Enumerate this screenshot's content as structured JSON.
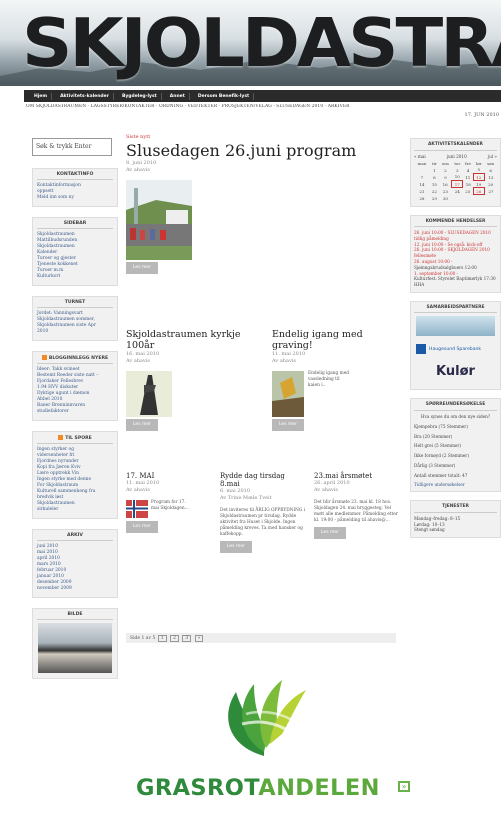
{
  "site": {
    "title": "SKJOLDASTRAUMEN",
    "nav": [
      "Hjem",
      "Aktivitets-kalender",
      "Bygdeleg-lyst",
      "Annet",
      "Dersom Benefik-lyst"
    ],
    "subnav": "OM SKJOLDASTRAUMEN · LAGSSTYRER/KONTAKTER · ORDNING · VEDTEKTER · PROSJEKTEN/VELAG · SLUSEDAGEN 2010 · ARKIVER",
    "date": "17. JUN 2010"
  },
  "left": {
    "search_placeholder": "Søk & trykk Enter",
    "boxes": [
      {
        "title": "Kontaktinfo",
        "lines": [
          "Kontaktinformasjon",
          "oppsett",
          "Meld inn som ny"
        ]
      },
      {
        "title": "Sidebar",
        "lines": [
          "Skjoldastraumen",
          "Mattilbudsrunden",
          "Skjoldastraumen",
          "Kalender",
          "Turoer og gjester",
          "Tjeneste kokkenet",
          "Turoer m.m",
          "Kulturkort"
        ]
      },
      {
        "title": "Turnet",
        "lines": [
          "Jordet: Vanningsvart Skjoldastraumen sommer, Skjoldastraumen siste Apr",
          "2010"
        ]
      },
      {
        "title": "Blogginnlegg nyere",
        "rss": true,
        "lines": [
          "Ideer: Takk svineet",
          "Bestemt Reeder siste natt – Fjordaker Fellesbrev",
          "1.94 HVV diskuter",
          "Dyktige ugunt i dæmon",
          "Abbel 2010",
          "Baner Brenninnvaren",
          "studiefaktorer"
        ]
      },
      {
        "title": "Til spore",
        "rss": true,
        "lines": [
          "Ingen styrker og",
          "vidersenheter fri",
          "Fjordnes nyrunder",
          "Kopi fra Jæren Kviv",
          "Lære opptrekk Vin",
          "Ingen styrke med denne",
          "For Skjoldastraum",
          "Kulturell sammenheng fra",
          "bredvik løst",
          "Skjoldastraumen",
          "sirkuleler"
        ]
      },
      {
        "title": "Arkiv",
        "lines": [
          "juni 2010",
          "mai 2010",
          "april 2010",
          "mars 2010",
          "februar 2010",
          "januar 2010",
          "desember 2009",
          "november 2009"
        ]
      },
      {
        "title": "Bilde",
        "lines": []
      }
    ]
  },
  "main": {
    "kicker": "Siste nytt",
    "featured": {
      "title": "Slusedagen 26.juni program",
      "date": "8. juni 2010",
      "author": "Av ahavis",
      "more": "Les mer"
    },
    "row2": [
      {
        "title": "Skjoldastraumen kyrkje 100år",
        "date": "16. mai 2010",
        "author": "Av ahavis",
        "more": "Les mer"
      },
      {
        "title": "Endelig igang med graving!",
        "date": "11. mai 2010",
        "author": "Av ahavis",
        "excerpt": "Endelig igang med vassledning til kaien i..",
        "more": "Les mer"
      }
    ],
    "row3": [
      {
        "title": "17. MAI",
        "date": "11. mai 2010",
        "author": "Av ahavis",
        "excerpt": "Program for 17. mai Skjoldagen...",
        "more": "Les mer"
      },
      {
        "title": "Rydde dag tirsdag 8.mai",
        "date": "6. mai 2010",
        "author": "Av Trine Mæle Tveit",
        "excerpt": "Det inviteres til ÅRLIG OPPRYDNING i Skjoldastraumen pr tirsdag. Rydde aktivitet fra Huset i Skjolde. Ingen påmelding kreves. Ta med hansker og kaffekopp.",
        "more": "Les mer"
      },
      {
        "title": "23.mai årsmøtet",
        "date": "26. april 2010",
        "author": "Av ahavis",
        "excerpt": "Det blir årsmøte 23. mai kl. 18 hos. Skjoldagen 24. mai bryggesteg. Vel møtt alle medlemmer. Påmelding etter kl. 19:00 - påmelding til ahavis@...",
        "more": "Les mer"
      }
    ],
    "pager": {
      "label": "Side 1 av 5",
      "pages": [
        "1",
        "2",
        "3",
        "»"
      ]
    }
  },
  "right": {
    "calendar": {
      "title": "Aktivitetskalender",
      "month": "juni 2010",
      "nav": [
        "« mai",
        "jul »"
      ],
      "weekdays": [
        "man",
        "tir",
        "ons",
        "tor",
        "fre",
        "lør",
        "søn"
      ],
      "weeks": [
        [
          "",
          "1",
          "2",
          "3",
          "4",
          "5",
          "6"
        ],
        [
          "7",
          "8",
          "9",
          "10",
          "11",
          "12",
          "13"
        ],
        [
          "14",
          "15",
          "16",
          "17",
          "18",
          "19",
          "20"
        ],
        [
          "21",
          "22",
          "23",
          "24",
          "25",
          "26",
          "27"
        ],
        [
          "28",
          "29",
          "30",
          "",
          "",
          "",
          ""
        ]
      ]
    },
    "events": {
      "title": "Kommende hendelser",
      "items": [
        "26. juni 10:00 - SLUSEDAGEN 2010 tidlig påmelding",
        "12. juni 10:00 - Se også: kick-off",
        "26. juni 10:00 - SKJOLDAGEN 2010 fellesmøte",
        "26. august 10:00 -",
        "Sjøinngabrudsalgbuers 12:00",
        "1. september 10:00 -",
        "Kulturfest: Styrelet Baptimørlyk 17:30 HHA"
      ]
    },
    "sponsors": {
      "title": "Samarbeidspartnere",
      "names": [
        "Haugesund Sparebank",
        "Kulør"
      ]
    },
    "poll": {
      "title": "Spørreundersøkelse",
      "question": "Hva synes du om den nye siden?",
      "options": [
        "Kjempebra (75 Stemmer)",
        "Bra (20 Stemmer)",
        "Helt grei (5 Stemmer)",
        "Ikke fornøyd (2 Stemmer)",
        "Dårlig (3 Stemmer)"
      ],
      "total": "Antall stemmer totalt: 47",
      "link": "Tidligere undersøkelser"
    },
    "contact": {
      "title": "Tjenester",
      "lines": [
        "Mandag–fredag: 8–15",
        "Lørdag: 10–13",
        "Stengt søndag"
      ]
    }
  },
  "logo": {
    "part1": "GRASROT",
    "part2": "ANDELEN",
    "mark": "»"
  }
}
